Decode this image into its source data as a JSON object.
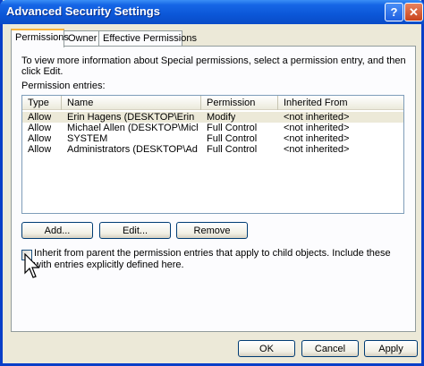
{
  "window": {
    "title": "Advanced Security Settings",
    "help_glyph": "?",
    "close_glyph": "✕"
  },
  "tabs": [
    {
      "label": "Permissions"
    },
    {
      "label": "Owner"
    },
    {
      "label": "Effective Permissions"
    }
  ],
  "info_text": "To view more information about Special permissions, select a permission entry, and then click Edit.",
  "entries_label": "Permission entries:",
  "columns": [
    "Type",
    "Name",
    "Permission",
    "Inherited From"
  ],
  "rows": [
    {
      "type": "Allow",
      "name": "Erin Hagens (DESKTOP\\Erin H...",
      "permission": "Modify",
      "inherited": "<not inherited>"
    },
    {
      "type": "Allow",
      "name": "Michael Allen (DESKTOP\\Mich...",
      "permission": "Full Control",
      "inherited": "<not inherited>"
    },
    {
      "type": "Allow",
      "name": "SYSTEM",
      "permission": "Full Control",
      "inherited": "<not inherited>"
    },
    {
      "type": "Allow",
      "name": "Administrators (DESKTOP\\Admi...",
      "permission": "Full Control",
      "inherited": "<not inherited>"
    }
  ],
  "buttons": {
    "add": "Add...",
    "edit": "Edit...",
    "remove": "Remove"
  },
  "inherit": {
    "label": "Inherit from parent the permission entries that apply to child objects. Include these with entries explicitly defined here.",
    "checked": false
  },
  "footer": {
    "ok": "OK",
    "cancel": "Cancel",
    "apply": "Apply"
  }
}
